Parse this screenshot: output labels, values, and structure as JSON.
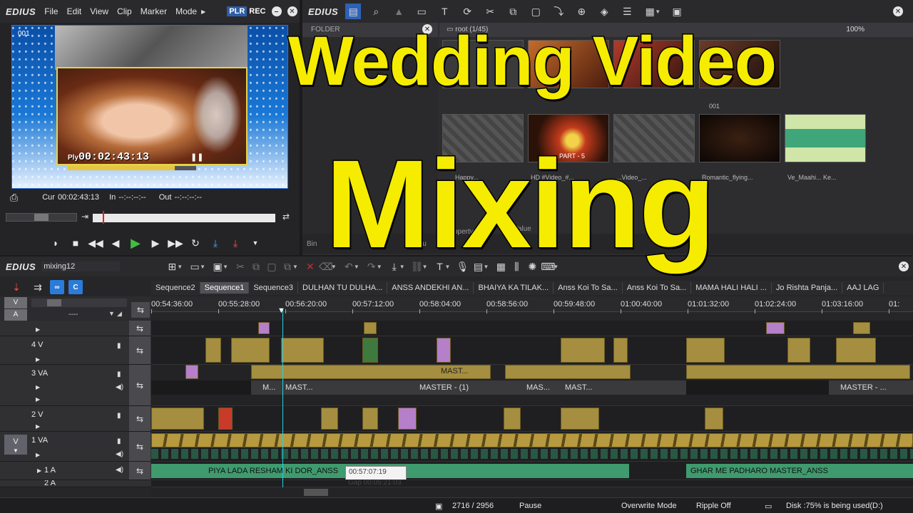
{
  "overlay": {
    "line1": "Wedding Video",
    "line2": "Mixing"
  },
  "player": {
    "logo": "EDIUS",
    "menu": [
      "File",
      "Edit",
      "View",
      "Clip",
      "Marker",
      "Mode"
    ],
    "plr": "PLR",
    "rec": "REC",
    "clip_number": "001",
    "ply_label": "Ply",
    "ply_timecode": "00:02:43:13",
    "cur_label": "Cur",
    "cur_timecode": "00:02:43:13",
    "in_label": "In",
    "in_timecode": "--:--:--:--",
    "out_label": "Out",
    "out_timecode": "--:--:--:--"
  },
  "bin": {
    "logo": "EDIUS",
    "folder_label": "FOLDER",
    "root_label": "root (1/45)",
    "zoom": "100%",
    "thumb_labels": [
      "PART - 5",
      "001",
      "Happy...",
      "HD #Video_#...",
      "...Video_...",
      "Romantic_flying...",
      "Ve_Maahi... Ke..."
    ],
    "bottom_labels": [
      "Bin",
      "operty",
      "Value",
      "Sou",
      "ser"
    ]
  },
  "timeline": {
    "logo": "EDIUS",
    "sequence_name": "mixing12",
    "tabs": [
      "Sequence2",
      "Sequence1",
      "Sequence3",
      "DULHAN TU DULHA...",
      "ANSS ANDEKHI AN...",
      "BHAIYA KA TILAK...",
      "Anss  Koi To Sa...",
      "Anss  Koi To Sa...",
      "MAMA HALI HALI ...",
      "Jo Rishta Panja...",
      "AAJ LAG"
    ],
    "active_tab": 1,
    "ruler": [
      "00:54:36:00",
      "00:55:28:00",
      "00:56:20:00",
      "00:57:12:00",
      "00:58:04:00",
      "00:58:56:00",
      "00:59:48:00",
      "01:00:40:00",
      "01:01:32:00",
      "01:02:24:00",
      "01:03:16:00",
      "01:"
    ],
    "va_v": "V",
    "va_a": "A",
    "va_dash": "----",
    "tracks": {
      "t4v": "4 V",
      "t3va": "3 VA",
      "t2v": "2 V",
      "t1va": "1 VA",
      "t1a": "1 A",
      "t2a": "2 A"
    },
    "tag_v": "V",
    "tag_a": "A",
    "master_labels": [
      "M...",
      "MAST...",
      "MASTER - (1)",
      "MAS...",
      "MAST...",
      "MASTER - ..."
    ],
    "master_top": "MAST...",
    "audio_clips": [
      "PIYA LADA RESHAM KI DOR_ANSS",
      "GHAR ME  PADHARO MASTER_ANSS"
    ],
    "tooltip_time": "00:57:07:19",
    "tooltip_gap": "Gap 00:05:21:03"
  },
  "status": {
    "frames": "2716 / 2956",
    "state": "Pause",
    "mode": "Overwrite Mode",
    "ripple": "Ripple Off",
    "disk": "Disk :75% is being used(D:)"
  },
  "colors": {
    "accent": "#2b7bd8",
    "title_yellow": "#f5ec00",
    "clip_gold": "#a58e3f",
    "audio_green": "#3f9a6e"
  }
}
